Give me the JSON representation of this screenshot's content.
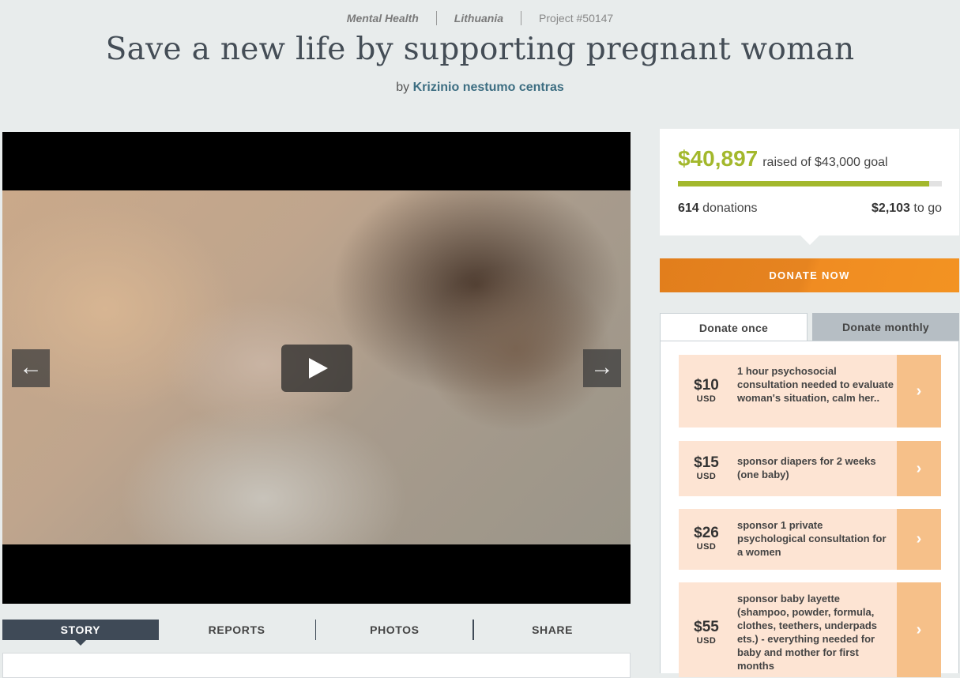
{
  "header": {
    "category": "Mental Health",
    "country": "Lithuania",
    "project_id": "Project #50147",
    "title": "Save a new life by supporting pregnant woman",
    "by_prefix": "by",
    "organization": "Krizinio nestumo centras"
  },
  "video": {
    "prev_arrow": "←",
    "next_arrow": "→"
  },
  "tabs": [
    "STORY",
    "REPORTS",
    "PHOTOS",
    "SHARE"
  ],
  "progress": {
    "raised": "$40,897",
    "raised_of": "raised of $43,000 goal",
    "fraction": 0.951,
    "donations_count": "614",
    "donations_label": "donations",
    "to_go_amount": "$2,103",
    "to_go_label": "to go"
  },
  "donate_button": "DONATE NOW",
  "donate_tabs": {
    "once": "Donate once",
    "monthly": "Donate monthly"
  },
  "options": [
    {
      "amount": "$10",
      "currency": "USD",
      "desc": "1 hour psychosocial consultation needed to evaluate woman's situation, calm her.."
    },
    {
      "amount": "$15",
      "currency": "USD",
      "desc": "sponsor diapers for 2 weeks (one baby)"
    },
    {
      "amount": "$26",
      "currency": "USD",
      "desc": "sponsor 1 private psychological consultation for a women"
    },
    {
      "amount": "$55",
      "currency": "USD",
      "desc": "sponsor baby layette (shampoo, powder, formula, clothes, teethers, underpads ets.) - everything needed for baby and mother for first months"
    }
  ],
  "option_arrow": "›",
  "colors": {
    "accent_green": "#a3b82c",
    "donate_orange": "#e98720",
    "tab_dark": "#3f4a57"
  }
}
